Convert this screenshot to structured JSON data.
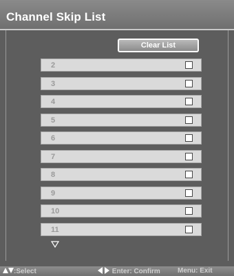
{
  "title": "Channel Skip List",
  "clear_button": "Clear List",
  "channels": [
    {
      "number": "2",
      "checked": false
    },
    {
      "number": "3",
      "checked": false
    },
    {
      "number": "4",
      "checked": false
    },
    {
      "number": "5",
      "checked": false
    },
    {
      "number": "6",
      "checked": false
    },
    {
      "number": "7",
      "checked": false
    },
    {
      "number": "8",
      "checked": false
    },
    {
      "number": "9",
      "checked": false
    },
    {
      "number": "10",
      "checked": false
    },
    {
      "number": "11",
      "checked": false
    }
  ],
  "help": {
    "select": ":Select",
    "enter": "Enter: Confirm",
    "menu": "Menu: Exit"
  },
  "icons": {
    "scroll_more": "down-triangle-icon",
    "updown": "up-down-arrows-icon",
    "leftright": "left-right-arrows-icon"
  }
}
